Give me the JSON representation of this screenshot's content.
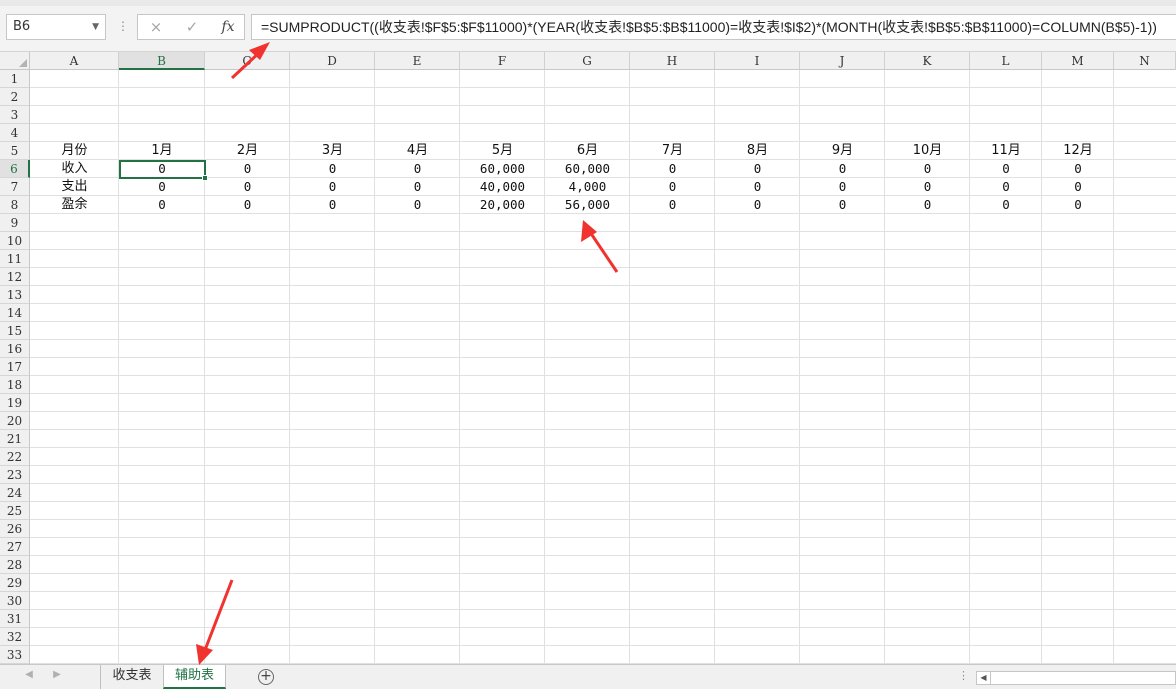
{
  "namebox": {
    "value": "B6"
  },
  "formula_bar": {
    "cancel_icon": "×",
    "confirm_icon": "✓",
    "fx_label": "fx",
    "formula": "=SUMPRODUCT((收支表!$F$5:$F$11000)*(YEAR(收支表!$B$5:$B$11000)=收支表!$I$2)*(MONTH(收支表!$B$5:$B$11000)=COLUMN(B$5)-1))"
  },
  "columns": [
    "A",
    "B",
    "C",
    "D",
    "E",
    "F",
    "G",
    "H",
    "I",
    "J",
    "K",
    "L",
    "M",
    "N"
  ],
  "rows": [
    "1",
    "2",
    "3",
    "4",
    "5",
    "6",
    "7",
    "8",
    "9",
    "10",
    "11",
    "12",
    "13",
    "14",
    "15",
    "16",
    "17",
    "18",
    "19",
    "20",
    "21",
    "22",
    "23",
    "24",
    "25",
    "26",
    "27",
    "28",
    "29",
    "30",
    "31",
    "32",
    "33"
  ],
  "table": {
    "header": [
      "月份",
      "1月",
      "2月",
      "3月",
      "4月",
      "5月",
      "6月",
      "7月",
      "8月",
      "9月",
      "10月",
      "11月",
      "12月"
    ],
    "income": [
      "收入",
      "0",
      "0",
      "0",
      "0",
      "60,000",
      "60,000",
      "0",
      "0",
      "0",
      "0",
      "0",
      "0"
    ],
    "expense": [
      "支出",
      "0",
      "0",
      "0",
      "0",
      "40,000",
      "4,000",
      "0",
      "0",
      "0",
      "0",
      "0",
      "0"
    ],
    "surplus": [
      "盈余",
      "0",
      "0",
      "0",
      "0",
      "20,000",
      "56,000",
      "0",
      "0",
      "0",
      "0",
      "0",
      "0"
    ]
  },
  "sheet_tabs": [
    "收支表",
    "辅助表"
  ],
  "active_sheet": "辅助表",
  "nav": {
    "prev": "◀",
    "next": "▶",
    "add": "+",
    "dots": "⋮",
    "scroll_left": "◀"
  },
  "accent_color": "#217346",
  "annotation_color": "#f0332f"
}
